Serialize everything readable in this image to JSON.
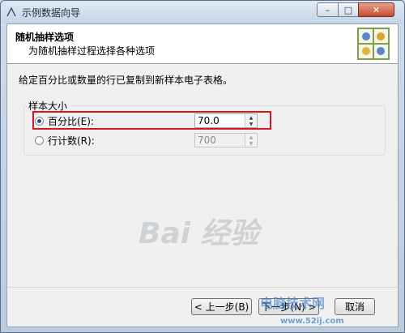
{
  "window": {
    "title": "示例数据向导",
    "minimize": "–",
    "maximize": "□",
    "close": "✕"
  },
  "header": {
    "title": "随机抽样选项",
    "subtitle": "为随机抽样过程选择各种选项"
  },
  "instruction": "给定百分比或数量的行已复制到新样本电子表格。",
  "sample_size": {
    "group_label": "样本大小",
    "options": [
      {
        "label": "百分比(E):",
        "selected": true,
        "value": "70.0",
        "enabled": true
      },
      {
        "label": "行计数(R):",
        "selected": false,
        "value": "700",
        "enabled": false
      }
    ]
  },
  "buttons": {
    "prev": "< 上一步(B)",
    "next": "下一步(N) >",
    "cancel": "取消"
  },
  "watermark": {
    "brand": "Bai 经验",
    "text": "电脑技术网",
    "url": "www.52ij.com"
  },
  "colors": {
    "highlight": "#d0181e",
    "titlebar": "#c5d5e6"
  }
}
